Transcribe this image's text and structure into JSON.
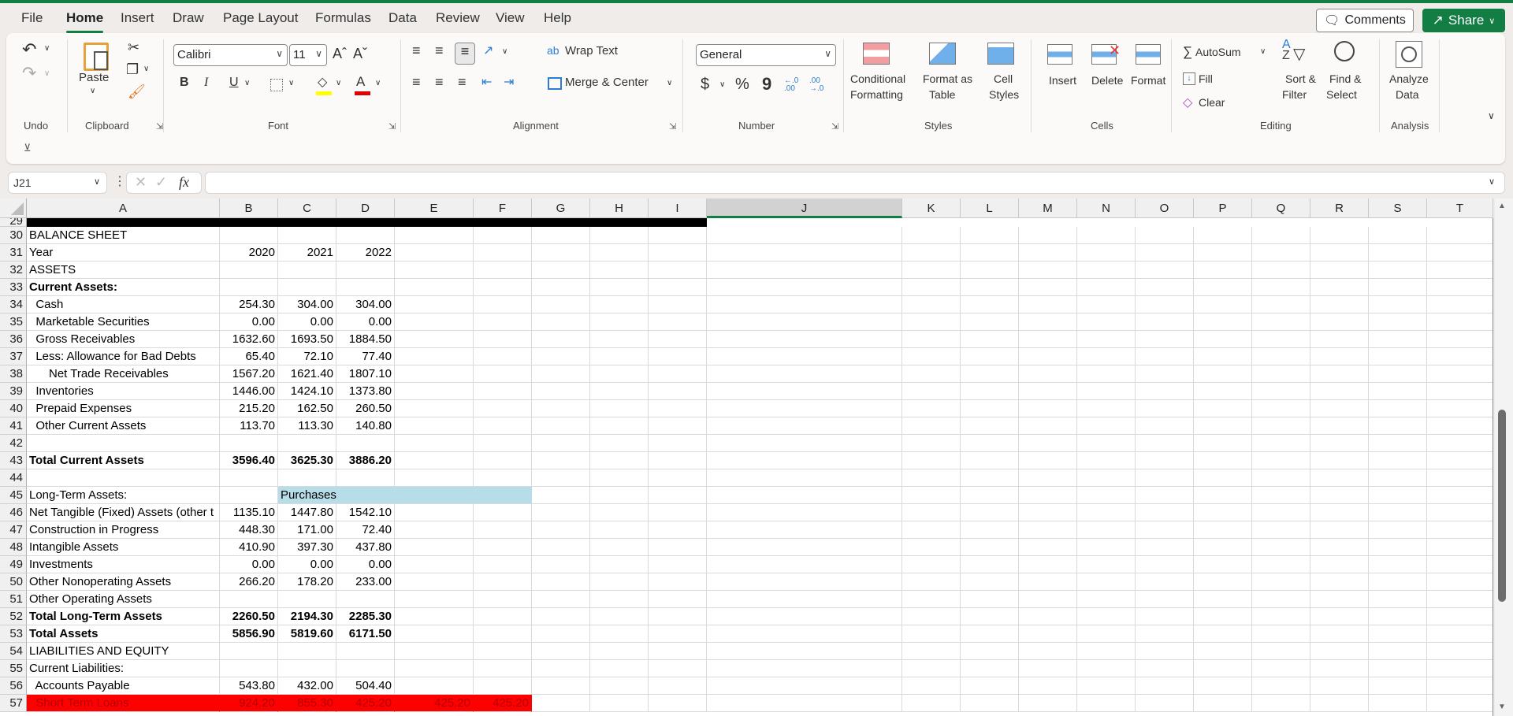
{
  "menu": {
    "tabs": [
      "File",
      "Home",
      "Insert",
      "Draw",
      "Page Layout",
      "Formulas",
      "Data",
      "Review",
      "View",
      "Help"
    ],
    "active_tab": "Home",
    "comments_label": "Comments",
    "share_label": "Share"
  },
  "ribbon": {
    "undo": {
      "label": "Undo"
    },
    "clipboard": {
      "label": "Clipboard",
      "paste": "Paste"
    },
    "font": {
      "label": "Font",
      "family": "Calibri",
      "size": "11",
      "bold": "B",
      "italic": "I",
      "underline": "U",
      "fill_color": "#ffff00",
      "font_color": "#e00000"
    },
    "alignment": {
      "label": "Alignment",
      "wrap_text": "Wrap Text",
      "merge_center": "Merge & Center"
    },
    "number": {
      "label": "Number",
      "format": "General",
      "currency": "$",
      "percent": "%",
      "comma": "9",
      "inc_decimal": "←.0 .00",
      "dec_decimal": ".00 →.0"
    },
    "styles": {
      "label": "Styles",
      "conditional": [
        "Conditional",
        "Formatting"
      ],
      "format_table": [
        "Format as",
        "Table"
      ],
      "cell_styles": [
        "Cell",
        "Styles"
      ]
    },
    "cells": {
      "label": "Cells",
      "insert": "Insert",
      "delete": "Delete",
      "format": "Format"
    },
    "editing": {
      "label": "Editing",
      "autosum": "AutoSum",
      "fill": "Fill",
      "clear": "Clear",
      "sort": [
        "Sort &",
        "Filter"
      ],
      "find": [
        "Find &",
        "Select"
      ]
    },
    "analysis": {
      "label": "Analysis",
      "analyze": [
        "Analyze",
        "Data"
      ]
    }
  },
  "formula_bar": {
    "name_box": "J21",
    "fx": "fx",
    "formula": ""
  },
  "columns": [
    "A",
    "B",
    "C",
    "D",
    "E",
    "F",
    "G",
    "H",
    "I",
    "J",
    "K",
    "L",
    "M",
    "N",
    "O",
    "P",
    "Q",
    "R",
    "S",
    "T"
  ],
  "selected_column": "J",
  "rows": [
    {
      "n": "29",
      "cells": {}
    },
    {
      "n": "30",
      "cells": {
        "A": "BALANCE SHEET"
      }
    },
    {
      "n": "31",
      "cells": {
        "A": "Year",
        "B": "2020",
        "C": "2021",
        "D": "2022"
      }
    },
    {
      "n": "32",
      "cells": {
        "A": "ASSETS"
      }
    },
    {
      "n": "33",
      "cells": {
        "A": "Current Assets:"
      },
      "bold": true
    },
    {
      "n": "34",
      "cells": {
        "A": "  Cash",
        "B": "254.30",
        "C": "304.00",
        "D": "304.00"
      }
    },
    {
      "n": "35",
      "cells": {
        "A": "  Marketable Securities",
        "B": "0.00",
        "C": "0.00",
        "D": "0.00"
      }
    },
    {
      "n": "36",
      "cells": {
        "A": "  Gross Receivables",
        "B": "1632.60",
        "C": "1693.50",
        "D": "1884.50"
      }
    },
    {
      "n": "37",
      "cells": {
        "A": "  Less: Allowance for Bad Debts",
        "B": "65.40",
        "C": "72.10",
        "D": "77.40"
      }
    },
    {
      "n": "38",
      "cells": {
        "A": "      Net Trade Receivables",
        "B": "1567.20",
        "C": "1621.40",
        "D": "1807.10"
      }
    },
    {
      "n": "39",
      "cells": {
        "A": "  Inventories",
        "B": "1446.00",
        "C": "1424.10",
        "D": "1373.80"
      }
    },
    {
      "n": "40",
      "cells": {
        "A": "  Prepaid Expenses",
        "B": "215.20",
        "C": "162.50",
        "D": "260.50"
      }
    },
    {
      "n": "41",
      "cells": {
        "A": "  Other Current Assets",
        "B": "113.70",
        "C": "113.30",
        "D": "140.80"
      }
    },
    {
      "n": "42",
      "cells": {}
    },
    {
      "n": "43",
      "cells": {
        "A": "Total Current Assets",
        "B": "3596.40",
        "C": "3625.30",
        "D": "3886.20"
      },
      "bold_a": true
    },
    {
      "n": "44",
      "cells": {}
    },
    {
      "n": "45",
      "cells": {
        "A": "Long-Term Assets:",
        "C": "Purchases"
      },
      "highlight": "#b7dde8"
    },
    {
      "n": "46",
      "cells": {
        "A": "Net Tangible (Fixed) Assets (other t",
        "B": "1135.10",
        "C": "1447.80",
        "D": "1542.10"
      }
    },
    {
      "n": "47",
      "cells": {
        "A": "Construction in Progress",
        "B": "448.30",
        "C": "171.00",
        "D": "72.40"
      }
    },
    {
      "n": "48",
      "cells": {
        "A": "Intangible Assets",
        "B": "410.90",
        "C": "397.30",
        "D": "437.80"
      }
    },
    {
      "n": "49",
      "cells": {
        "A": "Investments",
        "B": "0.00",
        "C": "0.00",
        "D": "0.00"
      }
    },
    {
      "n": "50",
      "cells": {
        "A": "Other Nonoperating Assets",
        "B": "266.20",
        "C": "178.20",
        "D": "233.00"
      }
    },
    {
      "n": "51",
      "cells": {
        "A": "Other Operating Assets"
      }
    },
    {
      "n": "52",
      "cells": {
        "A": "Total Long-Term Assets",
        "B": "2260.50",
        "C": "2194.30",
        "D": "2285.30"
      },
      "bold_a": true
    },
    {
      "n": "53",
      "cells": {
        "A": "Total Assets",
        "B": "5856.90",
        "C": "5819.60",
        "D": "6171.50"
      },
      "bold": true
    },
    {
      "n": "54",
      "cells": {
        "A": "LIABILITIES AND EQUITY"
      }
    },
    {
      "n": "55",
      "cells": {
        "A": "Current Liabilities:"
      }
    },
    {
      "n": "56",
      "cells": {
        "A": "  Accounts Payable",
        "B": "543.80",
        "C": "432.00",
        "D": "504.40"
      }
    },
    {
      "n": "57",
      "cells": {
        "A": "  Short Term Loans",
        "B": "924.20",
        "C": "855.30",
        "D": "425.20",
        "E": "425.20",
        "F": "425.20"
      },
      "fill": "#ff0000",
      "text_color": "#b00000"
    }
  ]
}
